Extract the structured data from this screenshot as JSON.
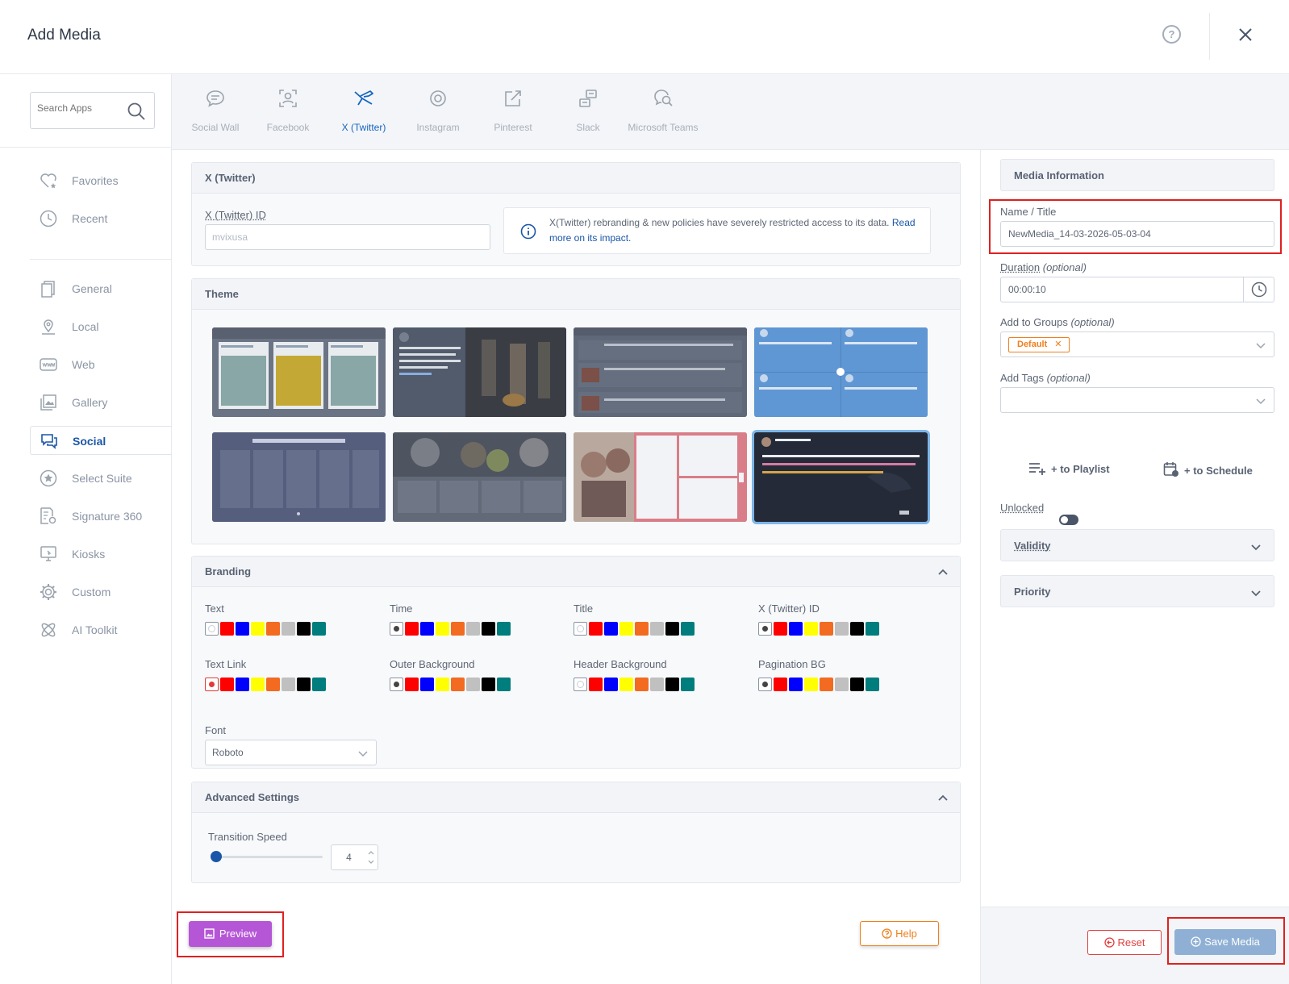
{
  "header": {
    "title": "Add Media",
    "help_label": "?",
    "close_label": "×"
  },
  "search": {
    "placeholder": "Search Apps"
  },
  "sidebar": {
    "items": [
      {
        "label": "Favorites"
      },
      {
        "label": "Recent"
      },
      {
        "label": "General"
      },
      {
        "label": "Local"
      },
      {
        "label": "Web"
      },
      {
        "label": "Gallery"
      },
      {
        "label": "Social"
      },
      {
        "label": "Select Suite"
      },
      {
        "label": "Signature 360"
      },
      {
        "label": "Kiosks"
      },
      {
        "label": "Custom"
      },
      {
        "label": "AI Toolkit"
      }
    ],
    "active": "Social"
  },
  "app_tabs": [
    {
      "label": "Social Wall"
    },
    {
      "label": "Facebook"
    },
    {
      "label": "X (Twitter)"
    },
    {
      "label": "Instagram"
    },
    {
      "label": "Pinterest"
    },
    {
      "label": "Slack"
    },
    {
      "label": "Microsoft Teams"
    }
  ],
  "active_tab": "X (Twitter)",
  "twitter_card": {
    "header": "X (Twitter)",
    "id_label": "X (Twitter) ID",
    "id_placeholder": "mvixusa",
    "info_text": "X(Twitter) rebranding & new policies have severely restricted access to its data. ",
    "info_link": "Read more on its impact."
  },
  "theme_card": {
    "header": "Theme",
    "selected_index": 7
  },
  "branding": {
    "header": "Branding",
    "palette": [
      "#ff0000",
      "#0000ff",
      "#ffff00",
      "#f26b21",
      "#c0c0c0",
      "#000000",
      "#007d7d"
    ],
    "groups": [
      {
        "label": "Text",
        "selected": "light"
      },
      {
        "label": "Time",
        "selected": "dark"
      },
      {
        "label": "Title",
        "selected": "light"
      },
      {
        "label": "X (Twitter) ID",
        "selected": "dark"
      },
      {
        "label": "Text Link",
        "selected": "red"
      },
      {
        "label": "Outer Background",
        "selected": "dark"
      },
      {
        "label": "Header Background",
        "selected": "light"
      },
      {
        "label": "Pagination BG",
        "selected": "dark"
      }
    ],
    "font_label": "Font",
    "font_value": "Roboto"
  },
  "advanced": {
    "header": "Advanced Settings",
    "transition_label": "Transition Speed",
    "transition_value": "4",
    "slider_fraction": 0
  },
  "buttons": {
    "preview": "Preview",
    "help": "Help",
    "reset": "Reset",
    "save": "Save Media"
  },
  "media_info": {
    "header": "Media Information",
    "name_label": "Name / Title",
    "name_value": "NewMedia_14-03-2026-05-03-04",
    "duration_label": "Duration",
    "duration_optional": "(optional)",
    "duration_value": "00:00:10",
    "groups_label": "Add to Groups",
    "groups_optional": "(optional)",
    "groups_tag": "Default",
    "tags_label": "Add Tags",
    "tags_optional": "(optional)",
    "to_playlist": "+ to Playlist",
    "to_schedule": "+ to Schedule",
    "unlocked_label": "Unlocked",
    "validity": "Validity",
    "priority": "Priority"
  }
}
